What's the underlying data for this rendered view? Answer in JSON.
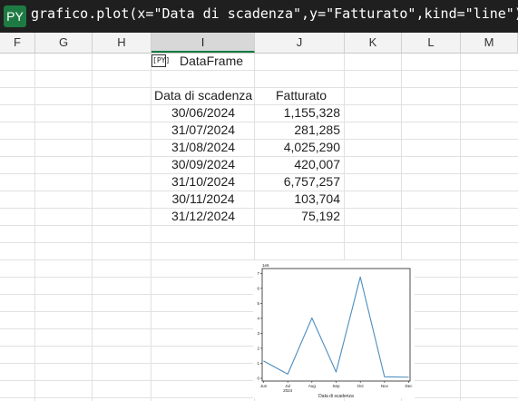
{
  "formula_bar": {
    "badge": "PY",
    "formula": "grafico.plot(x=\"Data di scadenza\",y=\"Fatturato\",kind=\"line\")"
  },
  "columns": [
    "F",
    "G",
    "H",
    "I",
    "J",
    "K",
    "L",
    "M"
  ],
  "selected_column": "I",
  "cells": {
    "py_icon": "[PY]",
    "dataframe_label": "DataFrame",
    "header_date": "Data di scadenza",
    "header_revenue": "Fatturato"
  },
  "table": [
    {
      "date": "30/06/2024",
      "revenue": "1,155,328"
    },
    {
      "date": "31/07/2024",
      "revenue": "281,285"
    },
    {
      "date": "31/08/2024",
      "revenue": "4,025,290"
    },
    {
      "date": "30/09/2024",
      "revenue": "420,007"
    },
    {
      "date": "31/10/2024",
      "revenue": "6,757,257"
    },
    {
      "date": "30/11/2024",
      "revenue": "103,704"
    },
    {
      "date": "31/12/2024",
      "revenue": "75,192"
    }
  ],
  "chart_data": {
    "type": "line",
    "x": [
      "30/06/2024",
      "31/07/2024",
      "31/08/2024",
      "30/09/2024",
      "31/10/2024",
      "30/11/2024",
      "31/12/2024"
    ],
    "series": [
      {
        "values": [
          1155328,
          281285,
          4025290,
          420007,
          6757257,
          103704,
          75192
        ]
      }
    ],
    "x_tick_labels": [
      "Jun",
      "Jul",
      "Aug",
      "Sep",
      "Oct",
      "Nov",
      "Dec"
    ],
    "x_year_label": "2024",
    "xlabel": "Data di scadenza",
    "ylabel": "",
    "y_offset_label": "1e6",
    "y_tick_labels": [
      "0",
      "1",
      "2",
      "3",
      "4",
      "5",
      "6",
      "7"
    ],
    "ylim": [
      0,
      7200000
    ],
    "line_color": "#4c8dbf",
    "grid": false
  }
}
